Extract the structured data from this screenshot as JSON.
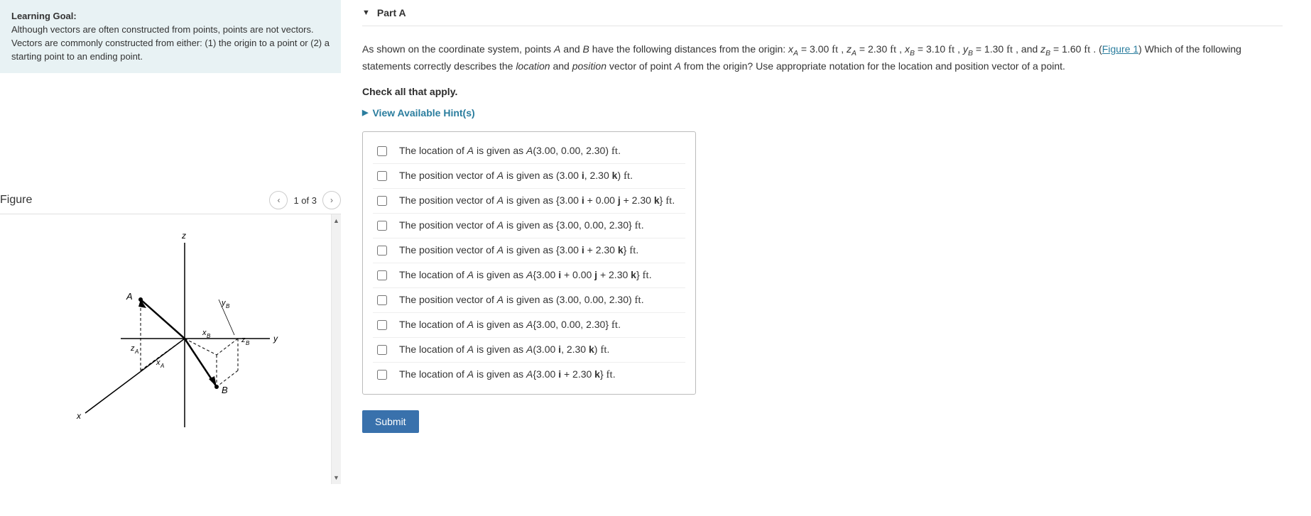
{
  "goal": {
    "title": "Learning Goal:",
    "body": "Although vectors are often constructed from points, points are not vectors. Vectors are commonly constructed from either: (1) the origin to a point or (2) a starting point to an ending point."
  },
  "figure": {
    "label": "Figure",
    "pager": "1 of 3",
    "axes": {
      "x": "x",
      "y": "y",
      "z": "z"
    },
    "labels": {
      "A": "A",
      "B": "B",
      "xA": "x_A",
      "zA": "z_A",
      "xB": "x_B",
      "yB": "y_B",
      "zB": "z_B"
    }
  },
  "part": {
    "label": "Part A",
    "problem_pre": "As shown on the coordinate system, points ",
    "values": {
      "xA": "3.00",
      "zA": "2.30",
      "xB": "3.10",
      "yB": "1.30",
      "zB": "1.60",
      "unit": "ft"
    },
    "problem_mid1": " and ",
    "problem_mid2": " have the following distances from the origin: ",
    "problem_post1": " . (",
    "figure_link": "Figure 1",
    "problem_post2": ") Which of the following statements correctly describes the ",
    "loc_word": "location",
    "problem_post3": " and ",
    "pos_word": "position",
    "problem_post4": " vector of point ",
    "problem_post5": " from the origin? Use appropriate notation for the location and position vector of a point.",
    "check": "Check all that apply.",
    "hints": "View Available Hint(s)"
  },
  "choices": [
    "The location of A is given as A(3.00, 0.00, 2.30) ft.",
    "The position vector of A is given as (3.00 i, 2.30 k) ft.",
    "The position vector of A is given as {3.00 i + 0.00 j + 2.30 k} ft.",
    "The position vector of A is given as {3.00, 0.00, 2.30} ft.",
    "The position vector of A is given as {3.00 i + 2.30 k} ft.",
    "The location of A is given as A{3.00 i + 0.00 j + 2.30 k} ft.",
    "The position vector of A is given as (3.00, 0.00, 2.30) ft.",
    "The location of A is given as A{3.00, 0.00, 2.30} ft.",
    "The location of A is given as A(3.00 i, 2.30 k) ft.",
    "The location of A is given as A{3.00 i + 2.30 k} ft."
  ],
  "submit": "Submit"
}
